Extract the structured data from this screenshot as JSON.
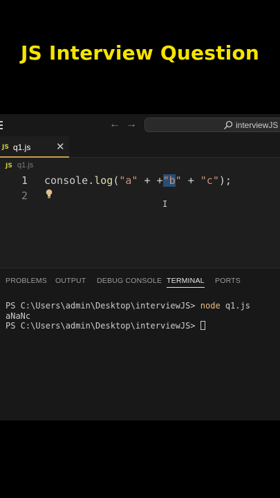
{
  "video_title": "JS Interview Question",
  "titlebar": {
    "search_label": "interviewJS"
  },
  "tab": {
    "badge": "JS",
    "name": "q1.js",
    "close": "✕"
  },
  "breadcrumb": {
    "badge": "JS",
    "name": "q1.js"
  },
  "code": {
    "line_numbers": [
      "1",
      "2"
    ],
    "tokens": {
      "console": "console",
      "dot": ".",
      "log": "log",
      "open": "(",
      "a": "\"a\"",
      "plus1": " + +",
      "b_q1": "\"",
      "b": "b",
      "b_q2": "\"",
      "plus2": " + ",
      "c": "\"c\"",
      "close": ");"
    }
  },
  "panel": {
    "tabs": [
      "PROBLEMS",
      "OUTPUT",
      "DEBUG CONSOLE",
      "TERMINAL",
      "PORTS"
    ],
    "active_tab": "TERMINAL",
    "terminal": {
      "prompt1": "PS C:\\Users\\admin\\Desktop\\interviewJS> ",
      "command": "node",
      "command_args": " q1.js",
      "output": "aNaNc",
      "prompt2": "PS C:\\Users\\admin\\Desktop\\interviewJS> "
    }
  }
}
